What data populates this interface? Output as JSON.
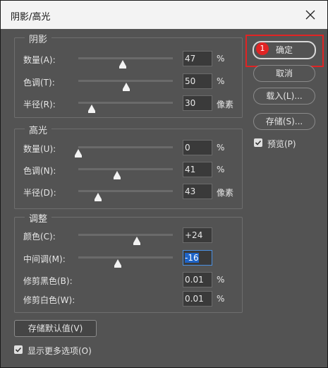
{
  "window": {
    "title": "阴影/高光"
  },
  "shadows": {
    "title": "阴影",
    "rows": [
      {
        "label": "数量(A):",
        "value": "47",
        "unit": "%",
        "level_percent": 47
      },
      {
        "label": "色调(T):",
        "value": "50",
        "unit": "%",
        "level_percent": 50
      },
      {
        "label": "半径(R):",
        "value": "30",
        "unit": "像素",
        "level_percent": 15
      }
    ]
  },
  "highlights": {
    "title": "高光",
    "rows": [
      {
        "label": "数量(U):",
        "value": "0",
        "unit": "%",
        "level_percent": 0
      },
      {
        "label": "色调(N):",
        "value": "41",
        "unit": "%",
        "level_percent": 41
      },
      {
        "label": "半径(D):",
        "value": "43",
        "unit": "像素",
        "level_percent": 21
      }
    ]
  },
  "adjustments": {
    "title": "调整",
    "color": {
      "label": "颜色(C):",
      "value": "+24",
      "level_percent": 62
    },
    "midtone": {
      "label": "中间调(M):",
      "value": "-16",
      "level_percent": 42
    },
    "clip_black": {
      "label": "修剪黑色(B):",
      "value": "0.01",
      "unit": "%"
    },
    "clip_white": {
      "label": "修剪白色(W):",
      "value": "0.01",
      "unit": "%"
    }
  },
  "buttons": {
    "ok": "确定",
    "cancel": "取消",
    "load": "载入(L)...",
    "save": "存储(S)...",
    "save_defaults": "存储默认值(V)"
  },
  "badge": "1",
  "preview": {
    "label": "预览(P)",
    "checked": true
  },
  "more_options": {
    "label": "显示更多选项(O)",
    "checked": true
  },
  "colors": {
    "highlight_border": "#e02424",
    "selection": "#1e64c8"
  }
}
